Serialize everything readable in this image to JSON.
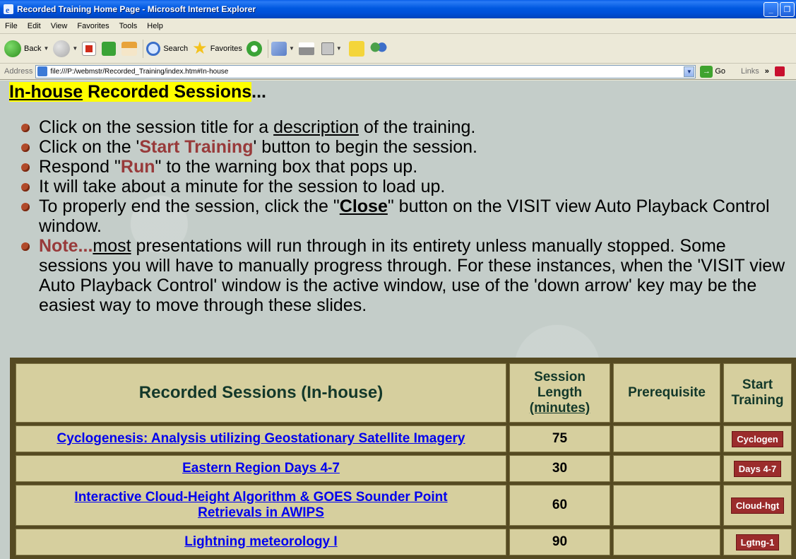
{
  "window": {
    "title": "Recorded Training Home Page - Microsoft Internet Explorer"
  },
  "menu": [
    "File",
    "Edit",
    "View",
    "Favorites",
    "Tools",
    "Help"
  ],
  "toolbar": {
    "back": "Back",
    "search": "Search",
    "favorites": "Favorites"
  },
  "address": {
    "label": "Address",
    "url": "file:///P:/webmstr/Recorded_Training/index.htm#In-house",
    "go": "Go",
    "links": "Links"
  },
  "page": {
    "heading_part1": "In-house",
    "heading_part2": " Recorded Sessions",
    "heading_part3": "...",
    "bullets": {
      "b1_pre": "Click on the session title for a ",
      "b1_link": "description",
      "b1_post": " of the training.",
      "b2_pre": "Click on the '",
      "b2_bold": "Start Training",
      "b2_post": "' button to begin the session.",
      "b3_pre": "Respond \"",
      "b3_bold": "Run",
      "b3_post": "\" to the warning box that pops up.",
      "b4": "It will take about a minute for the session to load up.",
      "b5_pre": "To properly end the session, click the \"",
      "b5_bold": "Close",
      "b5_post": "\" button on the VISIT view Auto Playback Control window.",
      "b6_bold": "Note...",
      "b6_u": "most",
      "b6_post": " presentations will run through in its entirety unless manually stopped. Some sessions you will have to manually progress through.  For these instances, when the 'VISIT view Auto Playback Control' window is the active window, use of the 'down arrow' key may be the easiest way to move through these slides."
    }
  },
  "table": {
    "header_title": "Recorded Sessions (In-house)",
    "header_length_1": "Session",
    "header_length_2": "Length",
    "header_length_3": "(minutes)",
    "header_prereq": "Prerequisite",
    "header_start_1": "Start",
    "header_start_2": "Training",
    "rows": [
      {
        "title": "Cyclogenesis: Analysis utilizing Geostationary Satellite Imagery",
        "length": "75",
        "prereq": "",
        "button": "Cyclogen"
      },
      {
        "title": "Eastern Region Days 4-7",
        "length": "30",
        "prereq": "",
        "button": "Days 4-7"
      },
      {
        "title": "Interactive Cloud-Height Algorithm & GOES Sounder Point Retrievals in AWIPS",
        "length": "60",
        "prereq": "",
        "button": "Cloud-hgt"
      },
      {
        "title": "Lightning meteorology I",
        "length": "90",
        "prereq": "",
        "button": "Lgtng-1"
      }
    ]
  }
}
